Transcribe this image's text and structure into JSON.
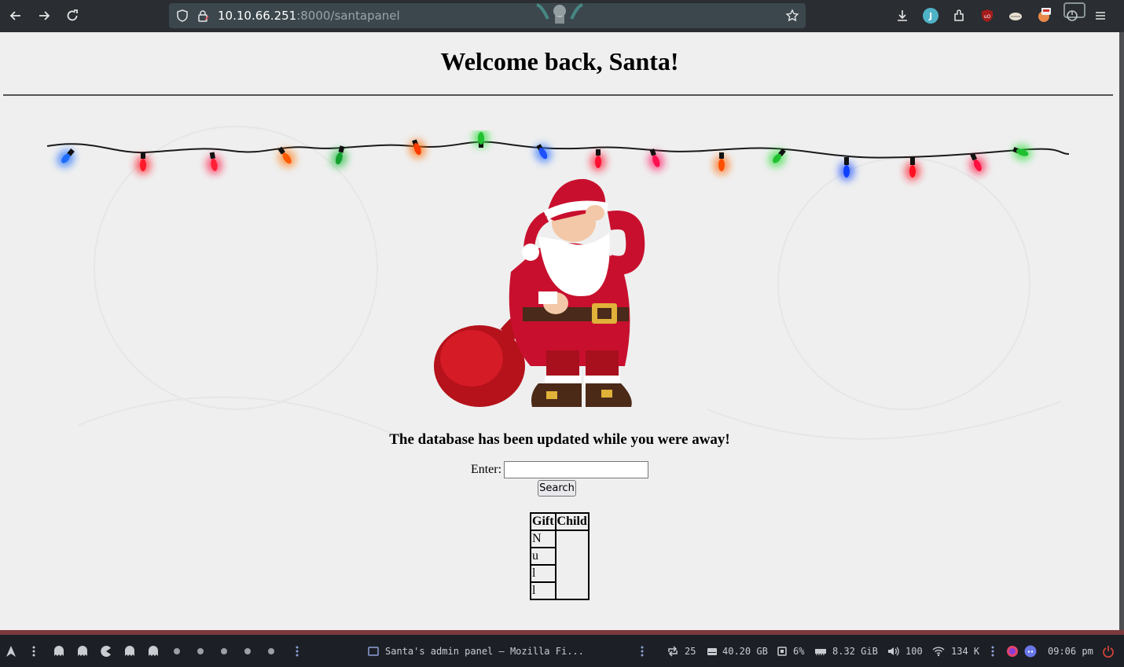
{
  "browser": {
    "url_host": "10.10.66.251",
    "url_rest": ":8000/santapanel",
    "toolbar_icons": [
      "back-icon",
      "forward-icon",
      "reload-icon",
      "shield-icon",
      "lock-icon",
      "bookmark-star-icon",
      "download-icon",
      "account-icon",
      "extensions-icon",
      "ublock-icon",
      "extension-icon",
      "extension-icon",
      "power-icon",
      "menu-icon"
    ],
    "account_initial": "J"
  },
  "page": {
    "heading": "Welcome back, Santa!",
    "notice": "The database has been updated while you were away!",
    "form": {
      "label": "Enter:",
      "input_value": "",
      "button_label": "Search"
    },
    "table": {
      "headers": [
        "Gift",
        "Child"
      ],
      "gift_column": [
        "N",
        "u",
        "l",
        "l"
      ]
    }
  },
  "taskbar": {
    "window_title": "Santa's admin panel — Mozilla Fi...",
    "updates": "25",
    "disk": "40.20 GB",
    "cpu": "6%",
    "memory": "8.32 GiB",
    "volume": "100",
    "network": "134 K",
    "clock": "09:06 pm"
  },
  "colors": {
    "toolbar": "#2a2d31",
    "urlbar": "#3b474d",
    "page_bg": "#efefef",
    "taskbar": "#1c2026",
    "santa_red": "#c8102e"
  }
}
